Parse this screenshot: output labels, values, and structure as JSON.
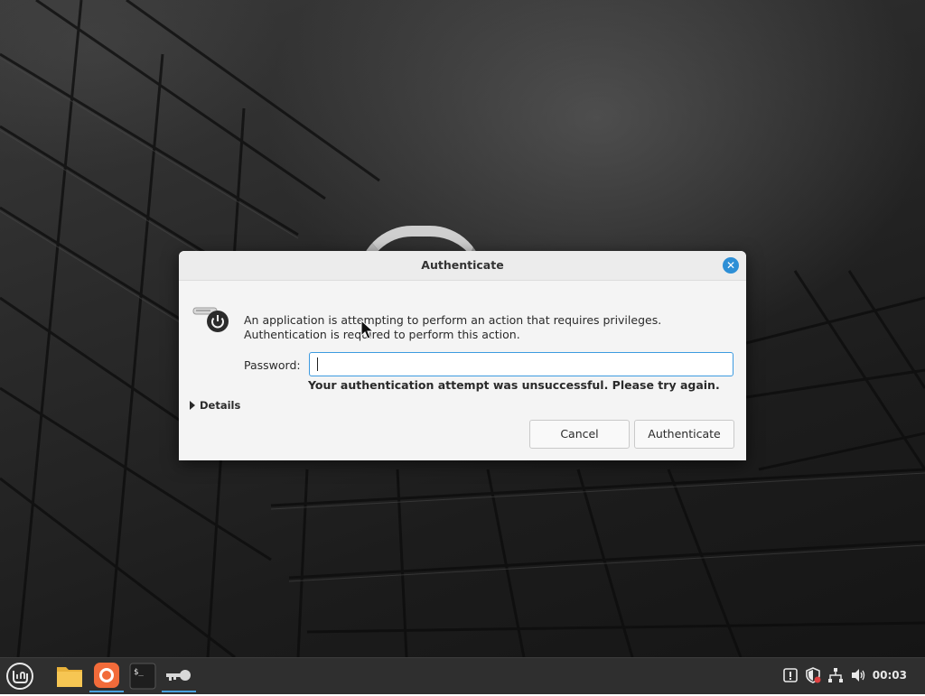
{
  "dialog": {
    "title": "Authenticate",
    "message": "An application is attempting to perform an action that requires privileges. Authentication is required to perform this action.",
    "password_label": "Password:",
    "password_value": "",
    "error": "Your authentication attempt was unsuccessful. Please try again.",
    "details_label": "Details",
    "cancel_label": "Cancel",
    "authenticate_label": "Authenticate"
  },
  "taskbar": {
    "menu_icon": "linux-mint-menu-icon",
    "apps": [
      {
        "name": "files-icon",
        "color": "#e9b23a"
      },
      {
        "name": "firefox-icon",
        "color": "#f26b3a"
      },
      {
        "name": "terminal-icon",
        "color": "#1e1e1e"
      },
      {
        "name": "keys-icon",
        "color": "#cfcfcf"
      }
    ],
    "clock": "00:03"
  },
  "colors": {
    "accent": "#3d9be0",
    "close_button": "#2d8fd6",
    "panel": "#2f2f2f"
  }
}
